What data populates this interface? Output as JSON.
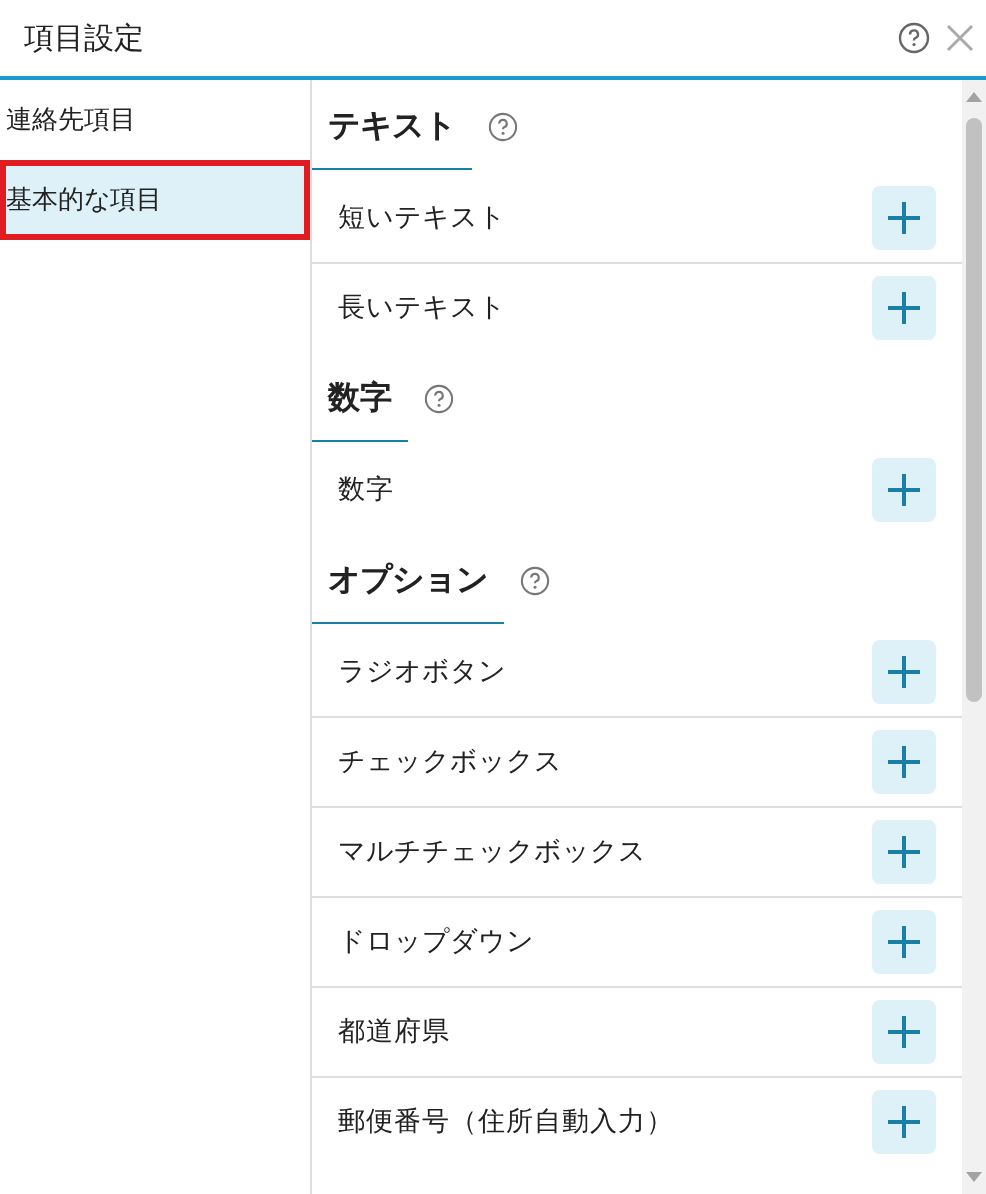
{
  "window": {
    "title": "項目設定"
  },
  "sidebar": {
    "items": [
      {
        "label": "連絡先項目",
        "selected": false
      },
      {
        "label": "基本的な項目",
        "selected": true
      }
    ]
  },
  "sections": [
    {
      "heading": "テキスト",
      "items": [
        "短いテキスト",
        "長いテキスト"
      ]
    },
    {
      "heading": "数字",
      "items": [
        "数字"
      ]
    },
    {
      "heading": "オプション",
      "items": [
        "ラジオボタン",
        "チェックボックス",
        "マルチチェックボックス",
        "ドロップダウン",
        "都道府県",
        "郵便番号（住所自動入力）"
      ]
    }
  ]
}
